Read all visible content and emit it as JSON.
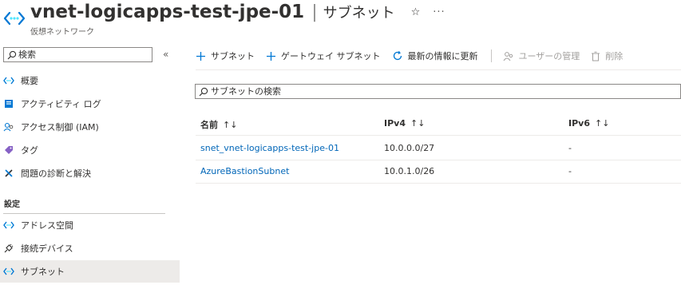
{
  "header": {
    "title": "vnet-logicapps-test-jpe-01",
    "separator": "|",
    "section": "サブネット",
    "subtitle": "仮想ネットワーク",
    "star": "☆",
    "more": "···"
  },
  "sidebar": {
    "search": {
      "placeholder": "検索",
      "value": ""
    },
    "collapse": "«",
    "items": [
      {
        "label": "概要",
        "icon": "vnet-icon"
      },
      {
        "label": "アクティビティ ログ",
        "icon": "activity-log-icon"
      },
      {
        "label": "アクセス制御 (IAM)",
        "icon": "iam-icon"
      },
      {
        "label": "タグ",
        "icon": "tag-icon"
      },
      {
        "label": "問題の診断と解決",
        "icon": "tools-icon"
      }
    ],
    "section_label": "設定",
    "settings_items": [
      {
        "label": "アドレス空間",
        "icon": "address-space-icon"
      },
      {
        "label": "接続デバイス",
        "icon": "plug-icon"
      },
      {
        "label": "サブネット",
        "icon": "subnet-icon",
        "selected": true
      }
    ]
  },
  "toolbar": {
    "add_subnet": "サブネット",
    "add_gateway_subnet": "ゲートウェイ サブネット",
    "refresh": "最新の情報に更新",
    "manage_users": "ユーザーの管理",
    "delete": "削除"
  },
  "filter": {
    "placeholder": "サブネットの検索",
    "value": ""
  },
  "table": {
    "columns": [
      "名前",
      "IPv4",
      "IPv6"
    ],
    "sort_glyph": "↑↓",
    "rows": [
      {
        "name": "snet_vnet-logicapps-test-jpe-01",
        "ipv4": "10.0.0.0/27",
        "ipv6": "-"
      },
      {
        "name": "AzureBastionSubnet",
        "ipv4": "10.0.1.0/26",
        "ipv6": "-"
      }
    ]
  },
  "colors": {
    "accent": "#0078d4",
    "link": "#0066b8",
    "selected_bg": "#edebe9",
    "text": "#323130"
  }
}
